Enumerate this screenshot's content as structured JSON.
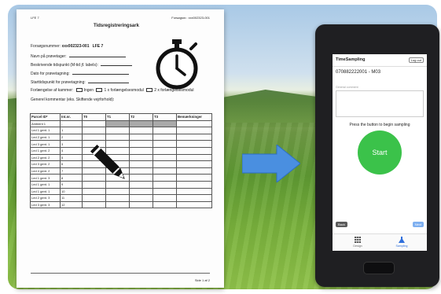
{
  "paper": {
    "header_left": "LFE 7",
    "header_right": "Forsøgsnr.: xxx002323-001",
    "title": "Tidsregistreringsark",
    "experiment_label": "Forsøgsnummer:",
    "experiment_value": "xxx002323-001",
    "experiment_unit": "LFE 7",
    "fields": [
      "Navn på prøvetager:",
      "Beskrivende tidspunkt (M-tid jf. labels):",
      "Dato for prøvetagning:",
      "Starttidspunkt for prøvetagning:"
    ],
    "extension_label": "Forlængelse af kammer:",
    "extension_options": [
      "Ingen",
      "1 x forlængelsesmodul",
      "2 x forlængelsesmodul"
    ],
    "general_comment": "Generel kommentar (eks. Skiftende vejrforhold):",
    "table": {
      "headers": [
        "Parcel ID*",
        "Int.nr.",
        "T0",
        "T1",
        "T2",
        "T3",
        "Bemærkninger"
      ],
      "rows": [
        [
          "Ambient 1",
          "-"
        ],
        [
          "Led 1 gent. 1",
          "1"
        ],
        [
          "Led 2 gent. 1",
          "2"
        ],
        [
          "Led 3 gent. 1",
          "3"
        ],
        [
          "Led 1 gent. 2",
          "4"
        ],
        [
          "Led 2 gent. 2",
          "5"
        ],
        [
          "Led 3 gent. 2",
          "6"
        ],
        [
          "Led 4 gent. 2",
          "7"
        ],
        [
          "Led 1 gent. 3",
          "8"
        ],
        [
          "Led 1 gent. 1",
          "9"
        ],
        [
          "Led 1 gent. 1",
          "10"
        ],
        [
          "Led 2 gent. 3",
          "11"
        ],
        [
          "Led 3 gent. 3",
          "12"
        ]
      ]
    },
    "footer": "Side 1 af 2"
  },
  "app": {
    "title": "TimeSampling",
    "logout_label": "Log out",
    "sample_id": "070882222001 - M03",
    "comment_label": "General comment",
    "prompt": "Press the button to begin sampling",
    "start_label": "Start",
    "back_label": "Back",
    "next_label": "Next",
    "tabs": [
      {
        "label": "Design",
        "icon": "grid-icon"
      },
      {
        "label": "Sampling",
        "icon": "flask-icon"
      }
    ],
    "colors": {
      "start": "#3bc24a",
      "active_tab": "#2f6fdc",
      "arrow": "#4a8fe0"
    }
  }
}
